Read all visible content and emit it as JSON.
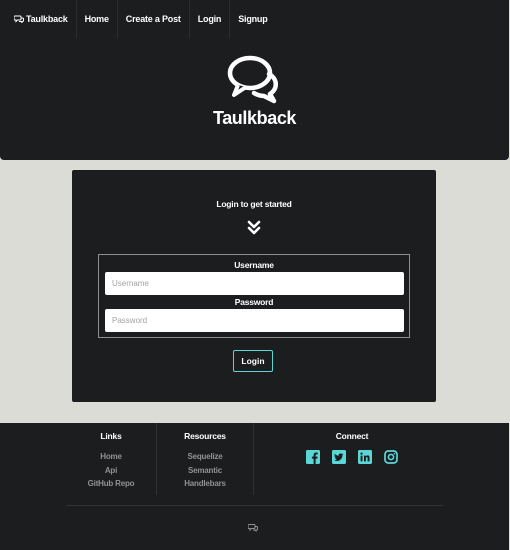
{
  "nav": {
    "brand": "Taulkback",
    "items": [
      "Home",
      "Create a Post",
      "Login",
      "Signup"
    ]
  },
  "hero": {
    "title": "Taulkback"
  },
  "login_card": {
    "heading": "Login to get started",
    "username_label": "Username",
    "username_placeholder": "Username",
    "password_label": "Password",
    "password_placeholder": "Password",
    "submit_label": "Login"
  },
  "footer": {
    "links": {
      "heading": "Links",
      "items": [
        "Home",
        "Api",
        "GitHub Repo"
      ]
    },
    "resources": {
      "heading": "Resources",
      "items": [
        "Sequelize",
        "Semantic",
        "Handlebars"
      ]
    },
    "connect": {
      "heading": "Connect",
      "icons": [
        "facebook-icon",
        "twitter-icon",
        "linkedin-icon",
        "instagram-icon"
      ]
    }
  },
  "colors": {
    "background": "#dcdcd6",
    "panel": "#1c1d1f",
    "accent": "#5bd6d6",
    "muted_text": "#8f9294"
  }
}
